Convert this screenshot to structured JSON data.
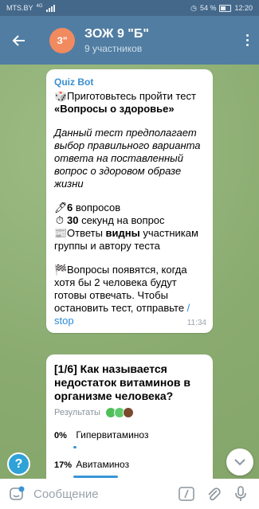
{
  "status_bar": {
    "carrier": "MTS.BY",
    "network": "4G",
    "battery_percent": "54 %",
    "time": "12:20"
  },
  "header": {
    "avatar_text": "З\"",
    "title": "ЗОЖ 9 \"Б\"",
    "subtitle": "9 участников"
  },
  "message1": {
    "sender": "Quiz Bot",
    "lines": [
      "Приготовьтесь пройти тест",
      "«Вопросы о здоровье»",
      "Данный тест предполагает",
      "выбор правильного варианта",
      "ответа на поставленный",
      "вопрос о здоровом образе",
      "жизни",
      "6",
      " вопросов",
      "30",
      " секунд на вопрос",
      "Ответы ",
      "видны",
      " участникам",
      "группы и автору теста",
      "Вопросы появятся, когда",
      "хотя бы 2 человека будут",
      "готовы отвечать. Чтобы",
      "остановить тест, отправьте ",
      "/",
      "stop"
    ],
    "time": "11:34"
  },
  "message2": {
    "question_lines": [
      "[1/6] Как называется",
      "недостаток витаминов в",
      "организме человека?"
    ],
    "results_label": "Результаты",
    "options": [
      {
        "pct": "0%",
        "label": "Гипервитаминоз",
        "share": 0
      },
      {
        "pct": "17%",
        "label": "Авитаминоз",
        "share": 0.17
      }
    ]
  },
  "help_button": "?",
  "input": {
    "placeholder": "Сообщение"
  },
  "colors": {
    "header": "#517da2",
    "accent": "#3a8fd0",
    "chat_bg": "#8fb078",
    "avatar": "#f28a5f"
  },
  "icons": [
    "back-arrow-icon",
    "menu-dots-icon",
    "sticker-emoji-icon",
    "command-slash-icon",
    "attach-paperclip-icon",
    "microphone-icon",
    "chevron-down-icon"
  ]
}
